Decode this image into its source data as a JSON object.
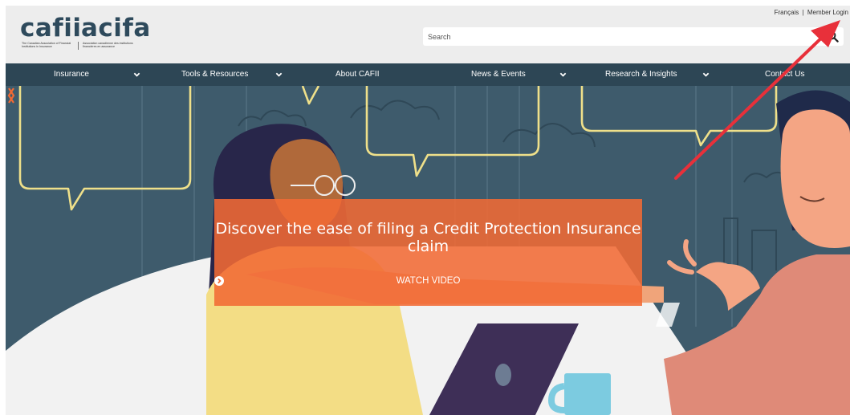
{
  "brand": {
    "logo_en": "cafii",
    "logo_fr": "acifa",
    "tagline_en": "The Canadian Association of Financial Institutions in Insurance",
    "tagline_fr": "Association canadienne des institutions financières en assurance",
    "colors": {
      "logo": "#2e4a5c",
      "nav": "#2d4655",
      "accent": "#f16a34"
    }
  },
  "top_links": {
    "language": "Français",
    "separator": "|",
    "member_login": "Member Login"
  },
  "search": {
    "placeholder": "Search",
    "value": "",
    "icon": "search-icon"
  },
  "nav": {
    "items": [
      {
        "label": "Insurance",
        "has_dropdown": true
      },
      {
        "label": "Tools & Resources",
        "has_dropdown": true
      },
      {
        "label": "About CAFII",
        "has_dropdown": false
      },
      {
        "label": "News & Events",
        "has_dropdown": true
      },
      {
        "label": "Research & Insights",
        "has_dropdown": true
      },
      {
        "label": "Contact Us",
        "has_dropdown": false
      }
    ]
  },
  "hero": {
    "title": "Discover the ease of filing a Credit Protection Insurance claim",
    "cta_label": "WATCH VIDEO",
    "cta_icon": "chevron-circle-right-icon",
    "prev_icon": "chevron-left-icon",
    "next_icon": "chevron-right-icon"
  },
  "annotation": {
    "type": "arrow",
    "color": "#e8303a",
    "points_to": "Member Login"
  }
}
